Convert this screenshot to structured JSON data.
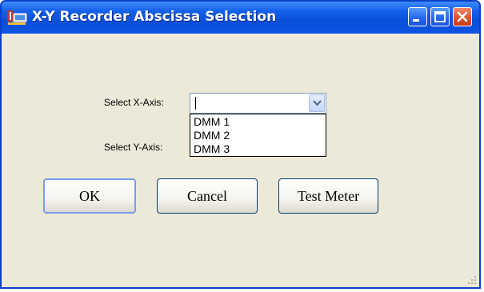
{
  "window": {
    "title": "X-Y Recorder Abscissa Selection",
    "title_bar_color": "#0a4fd7",
    "body_color": "#ece9d8",
    "close_button_color": "#e2522b"
  },
  "title_bar_buttons": {
    "minimize_icon": "minimize-icon",
    "maximize_icon": "maximize-icon",
    "close_icon": "close-icon"
  },
  "form": {
    "x_axis_label": "Select X-Axis:",
    "y_axis_label": "Select Y-Axis:",
    "x_axis_value": "",
    "x_axis_dropdown_open": true,
    "dropdown_options": [
      "DMM 1",
      "DMM 2",
      "DMM 3"
    ]
  },
  "buttons": {
    "ok_label": "OK",
    "cancel_label": "Cancel",
    "test_meter_label": "Test Meter"
  }
}
